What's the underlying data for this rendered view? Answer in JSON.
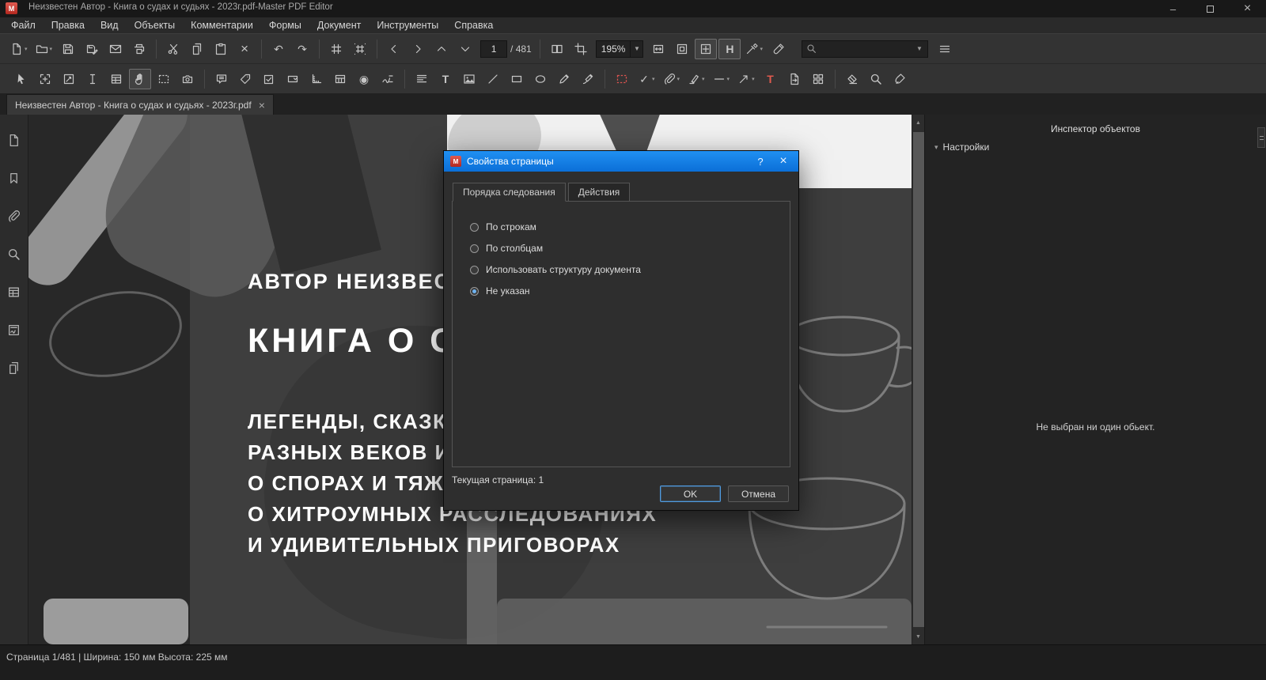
{
  "window": {
    "title": "Неизвестен Автор - Книга о судах и судьях - 2023г.pdf-Master PDF Editor"
  },
  "menu": {
    "items": [
      {
        "name": "menu-file",
        "label": "Файл"
      },
      {
        "name": "menu-edit",
        "label": "Правка"
      },
      {
        "name": "menu-view",
        "label": "Вид"
      },
      {
        "name": "menu-objects",
        "label": "Объекты"
      },
      {
        "name": "menu-comments",
        "label": "Комментарии"
      },
      {
        "name": "menu-forms",
        "label": "Формы"
      },
      {
        "name": "menu-document",
        "label": "Документ"
      },
      {
        "name": "menu-tools",
        "label": "Инструменты"
      },
      {
        "name": "menu-help",
        "label": "Справка"
      }
    ]
  },
  "toolbar1": {
    "page_value": "1",
    "page_total": "/ 481",
    "zoom_value": "195%",
    "items": [
      {
        "t": "btn",
        "name": "new-document",
        "icon": "doc",
        "dd": true
      },
      {
        "t": "btn",
        "name": "open-file",
        "icon": "folder",
        "dd": true
      },
      {
        "t": "btn",
        "name": "save",
        "icon": "floppy"
      },
      {
        "t": "btn",
        "name": "save-as",
        "icon": "floppypen"
      },
      {
        "t": "btn",
        "name": "send-email",
        "icon": "envelope"
      },
      {
        "t": "btn",
        "name": "print",
        "icon": "printer"
      },
      {
        "t": "sep"
      },
      {
        "t": "btn",
        "name": "cut",
        "icon": "scissors"
      },
      {
        "t": "btn",
        "name": "copy",
        "icon": "copy"
      },
      {
        "t": "btn",
        "name": "paste",
        "icon": "paste"
      },
      {
        "t": "btn",
        "name": "delete",
        "icon": "xmark"
      },
      {
        "t": "sep"
      },
      {
        "t": "btn",
        "name": "undo",
        "icon": "undo"
      },
      {
        "t": "btn",
        "name": "redo",
        "icon": "redo"
      },
      {
        "t": "sep"
      },
      {
        "t": "btn",
        "name": "show-grid",
        "icon": "hash"
      },
      {
        "t": "btn",
        "name": "snap-to-grid",
        "icon": "hashdots"
      },
      {
        "t": "sep"
      },
      {
        "t": "btn",
        "name": "previous-page",
        "icon": "chevl"
      },
      {
        "t": "btn",
        "name": "next-page",
        "icon": "chevr"
      },
      {
        "t": "btn",
        "name": "page-up",
        "icon": "chevu"
      },
      {
        "t": "btn",
        "name": "page-down",
        "icon": "chevd"
      },
      {
        "t": "pageinput"
      },
      {
        "t": "sep"
      },
      {
        "t": "btn",
        "name": "page-layout",
        "icon": "twopage"
      },
      {
        "t": "btn",
        "name": "crop-pages",
        "icon": "crop"
      },
      {
        "t": "zoomselect"
      },
      {
        "t": "btn",
        "name": "zoom-fit-width",
        "icon": "fitw"
      },
      {
        "t": "btn",
        "name": "zoom-fit-page",
        "icon": "fitp"
      },
      {
        "t": "btn",
        "name": "zoom-fit-visible",
        "icon": "fitv",
        "active": true
      },
      {
        "t": "btn",
        "name": "hand-h-mode",
        "icon": "hletter",
        "active": true
      },
      {
        "t": "btn",
        "name": "color-picker",
        "icon": "dropper",
        "dd": true
      },
      {
        "t": "btn",
        "name": "format-painter",
        "icon": "dropper2"
      },
      {
        "t": "searchbox"
      },
      {
        "t": "btn",
        "name": "toolbar-options",
        "icon": "menu"
      }
    ]
  },
  "toolbar2": {
    "items": [
      {
        "t": "btn",
        "name": "select-tool",
        "icon": "cursor"
      },
      {
        "t": "btn",
        "name": "edit-page-boxes",
        "icon": "frameedit"
      },
      {
        "t": "btn",
        "name": "edit-objects",
        "icon": "objedit"
      },
      {
        "t": "btn",
        "name": "select-text",
        "icon": "textsel"
      },
      {
        "t": "btn",
        "name": "edit-forms",
        "icon": "tableicon"
      },
      {
        "t": "btn",
        "name": "hand-tool",
        "icon": "hand",
        "active": true
      },
      {
        "t": "btn",
        "name": "marquee-zoom",
        "icon": "dashrect2"
      },
      {
        "t": "btn",
        "name": "snapshot",
        "icon": "camera"
      },
      {
        "t": "sep"
      },
      {
        "t": "btn",
        "name": "add-sticky-note",
        "icon": "note"
      },
      {
        "t": "btn",
        "name": "add-text-callout",
        "icon": "tag"
      },
      {
        "t": "btn",
        "name": "add-checkbox-field",
        "icon": "checkboxicon"
      },
      {
        "t": "btn",
        "name": "add-listbox-field",
        "icon": "combo"
      },
      {
        "t": "btn",
        "name": "measure-tool",
        "icon": "rulerL"
      },
      {
        "t": "btn",
        "name": "add-table-field",
        "icon": "formtable"
      },
      {
        "t": "btn",
        "name": "add-radio-field",
        "icon": "radioicon"
      },
      {
        "t": "btn",
        "name": "add-signature-field",
        "icon": "sigfield"
      },
      {
        "t": "sep"
      },
      {
        "t": "btn",
        "name": "text-align",
        "icon": "paragraph"
      },
      {
        "t": "btn",
        "name": "add-text",
        "icon": "textplus"
      },
      {
        "t": "btn",
        "name": "add-image",
        "icon": "imageicon"
      },
      {
        "t": "btn",
        "name": "draw-line",
        "icon": "lineicon"
      },
      {
        "t": "btn",
        "name": "draw-rectangle",
        "icon": "recticon"
      },
      {
        "t": "btn",
        "name": "draw-ellipse",
        "icon": "ellipseicon"
      },
      {
        "t": "btn",
        "name": "pencil-tool",
        "icon": "penicon"
      },
      {
        "t": "btn",
        "name": "ink-signature",
        "icon": "inkpen"
      },
      {
        "t": "sep"
      },
      {
        "t": "btn",
        "name": "active-region",
        "icon": "reddash"
      },
      {
        "t": "btn",
        "name": "stamp-check",
        "icon": "checkmark",
        "dd": true
      },
      {
        "t": "btn",
        "name": "attach-file-comment",
        "icon": "clipicon",
        "dd": true
      },
      {
        "t": "btn",
        "name": "highlight-text",
        "icon": "hlpen",
        "dd": true
      },
      {
        "t": "btn",
        "name": "line-style",
        "icon": "strikeline",
        "dd": true
      },
      {
        "t": "btn",
        "name": "arrow-style",
        "icon": "arrowne",
        "dd": true
      },
      {
        "t": "btn",
        "name": "text-format",
        "icon": "tred"
      },
      {
        "t": "btn",
        "name": "export-page",
        "icon": "exportpage"
      },
      {
        "t": "btn",
        "name": "arrange-blocks",
        "icon": "blocksicon"
      },
      {
        "t": "sep"
      },
      {
        "t": "btn",
        "name": "eraser-tool",
        "icon": "eraser"
      },
      {
        "t": "btn",
        "name": "zoom-tool",
        "icon": "zoomglass"
      },
      {
        "t": "btn",
        "name": "clear-formatting",
        "icon": "cleanbrush"
      }
    ]
  },
  "tab": {
    "label": "Неизвестен Автор - Книга о судах и судьях - 2023г.pdf"
  },
  "sidebar": {
    "items": [
      {
        "name": "sidebar-pages",
        "icon": "doc"
      },
      {
        "name": "sidebar-bookmarks",
        "icon": "bookmark"
      },
      {
        "name": "sidebar-attachments",
        "icon": "clipicon"
      },
      {
        "name": "sidebar-search",
        "icon": "zoomglass"
      },
      {
        "name": "sidebar-form-fields",
        "icon": "tableicon"
      },
      {
        "name": "sidebar-signatures",
        "icon": "sigbadge"
      },
      {
        "name": "sidebar-layers",
        "icon": "copy"
      }
    ]
  },
  "document": {
    "author_line": "АВТОР НЕИЗВЕСТЕН",
    "title_line": "КНИГА О СУДАХ И СУДЬЯХ",
    "subtitle_lines": [
      "ЛЕГЕНДЫ, СКАЗКИ, БАСНИ",
      "РАЗНЫХ ВЕКОВ И НАРОДОВ",
      "О СПОРАХ И ТЯЖБАХ,",
      "О ХИТРОУМНЫХ РАССЛЕДОВАНИЯХ",
      "И УДИВИТЕЛЬНЫХ ПРИГОВОРАХ"
    ]
  },
  "dialog": {
    "title": "Свойства страницы",
    "help_label": "?",
    "tabs": [
      {
        "name": "tab-order",
        "label": "Порядка следования",
        "active": true
      },
      {
        "name": "actions",
        "label": "Действия",
        "active": false
      }
    ],
    "options": [
      {
        "name": "by-rows",
        "label": "По строкам",
        "selected": false
      },
      {
        "name": "by-columns",
        "label": "По столбцам",
        "selected": false
      },
      {
        "name": "use-document-structure",
        "label": "Использовать структуру документа",
        "selected": false
      },
      {
        "name": "unspecified",
        "label": "Не указан",
        "selected": true
      }
    ],
    "current_page": "Текущая страница: 1",
    "ok_label": "OK",
    "cancel_label": "Отмена"
  },
  "inspector": {
    "title": "Инспектор объектов",
    "section": "Настройки",
    "empty_text": "Не выбран ни один обьект."
  },
  "statusbar": {
    "text": "Страница 1/481 | Ширина: 150 мм Высота: 225 мм"
  }
}
